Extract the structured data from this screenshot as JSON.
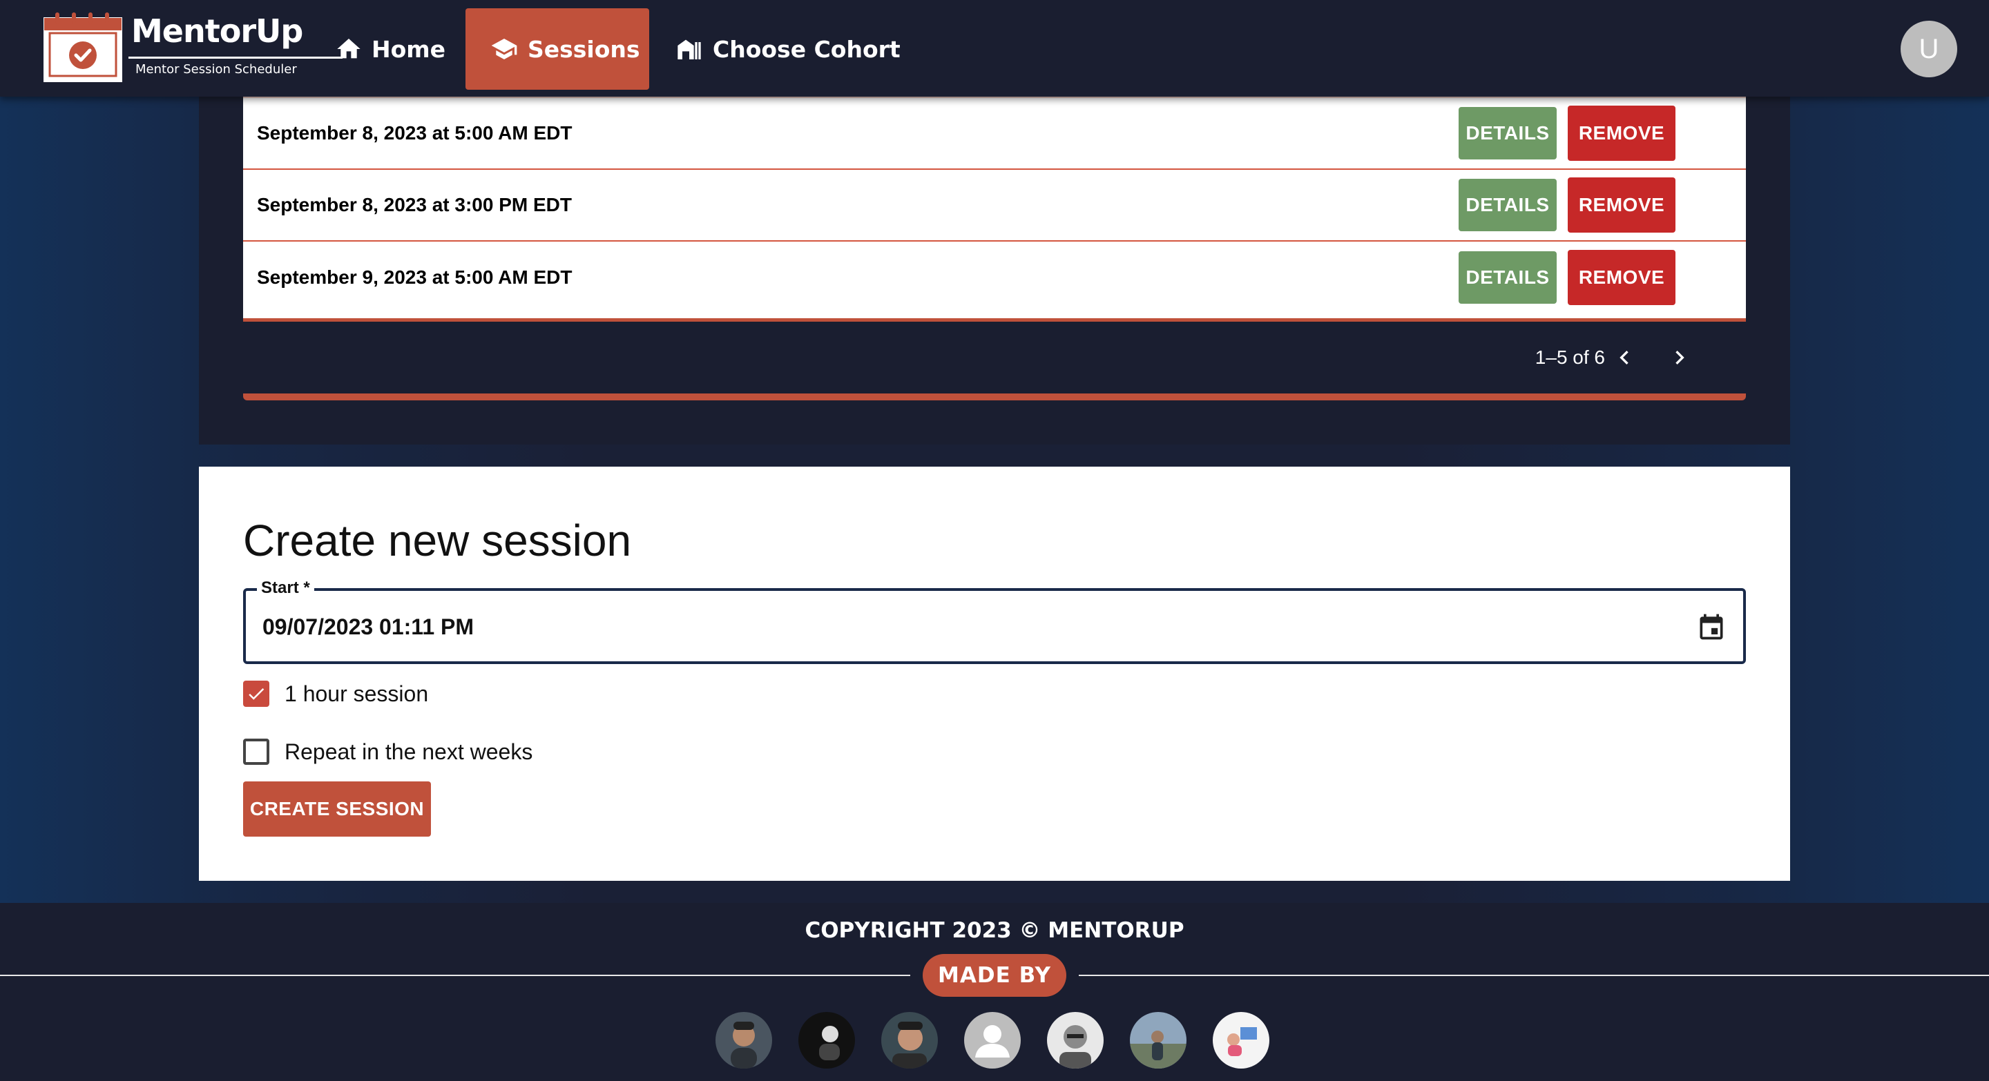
{
  "navbar": {
    "brand_name": "MentorUp",
    "brand_tagline": "Mentor Session Scheduler",
    "items": [
      {
        "label": "Home",
        "icon": "home-icon"
      },
      {
        "label": "Sessions",
        "icon": "graduation-cap-icon",
        "active": true
      },
      {
        "label": "Choose Cohort",
        "icon": "cohort-icon"
      }
    ],
    "avatar_initial": "U"
  },
  "sessions": {
    "rows": [
      {
        "date": "September 8, 2023 at 5:00 AM EDT",
        "details_label": "DETAILS",
        "remove_label": "REMOVE"
      },
      {
        "date": "September 8, 2023 at 3:00 PM EDT",
        "details_label": "DETAILS",
        "remove_label": "REMOVE"
      },
      {
        "date": "September 9, 2023 at 5:00 AM EDT",
        "details_label": "DETAILS",
        "remove_label": "REMOVE"
      }
    ],
    "pagination": "1–5 of 6"
  },
  "create": {
    "title": "Create new session",
    "start_label": "Start *",
    "start_value": "09/07/2023 01:11 PM",
    "one_hour_label": "1 hour session",
    "one_hour_checked": true,
    "repeat_label": "Repeat in the next weeks",
    "repeat_checked": false,
    "submit_label": "CREATE SESSION"
  },
  "footer": {
    "copyright": "COPYRIGHT 2023 © MENTORUP",
    "made_by": "MADE BY",
    "team_count": 7
  },
  "colors": {
    "accent": "#c0513b",
    "navbar_bg": "#1a1e30",
    "details_green": "#6e9a65",
    "remove_red": "#c62828"
  }
}
